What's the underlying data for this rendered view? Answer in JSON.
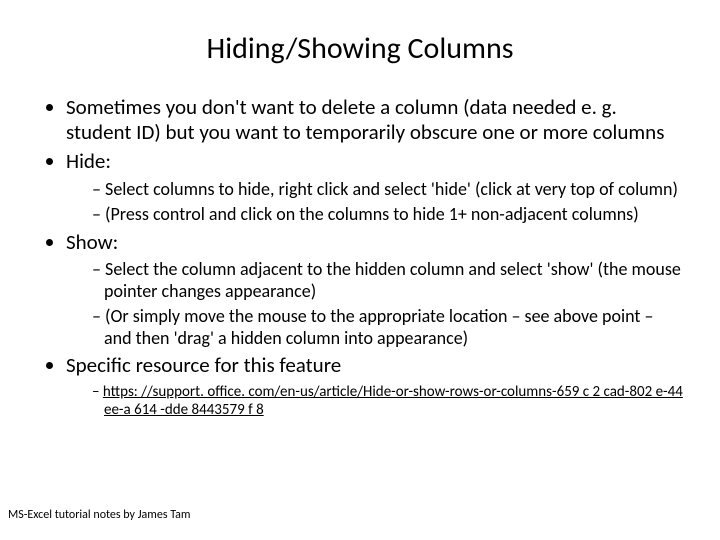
{
  "title": "Hiding/Showing Columns",
  "b1": "Sometimes you don't want to delete a column (data needed e. g. student ID) but you want to temporarily obscure one or more columns",
  "b2": "Hide:",
  "b2s1": "Select columns to hide, right click and select 'hide' (click at very top of column)",
  "b2s2": "(Press control and click on the columns to hide 1+ non-adjacent columns)",
  "b3": "Show:",
  "b3s1": "Select the column adjacent to the hidden column and select 'show' (the mouse pointer changes appearance)",
  "b3s2": "(Or simply move the mouse to the appropriate location – see above point – and then 'drag' a hidden column into appearance)",
  "b4": "Specific resource for this feature",
  "b4link": "https: //support. office. com/en-us/article/Hide-or-show-rows-or-columns-659 c 2 cad-802 e-44 ee-a 614 -dde 8443579 f 8",
  "footer": "MS-Excel tutorial notes by James Tam"
}
